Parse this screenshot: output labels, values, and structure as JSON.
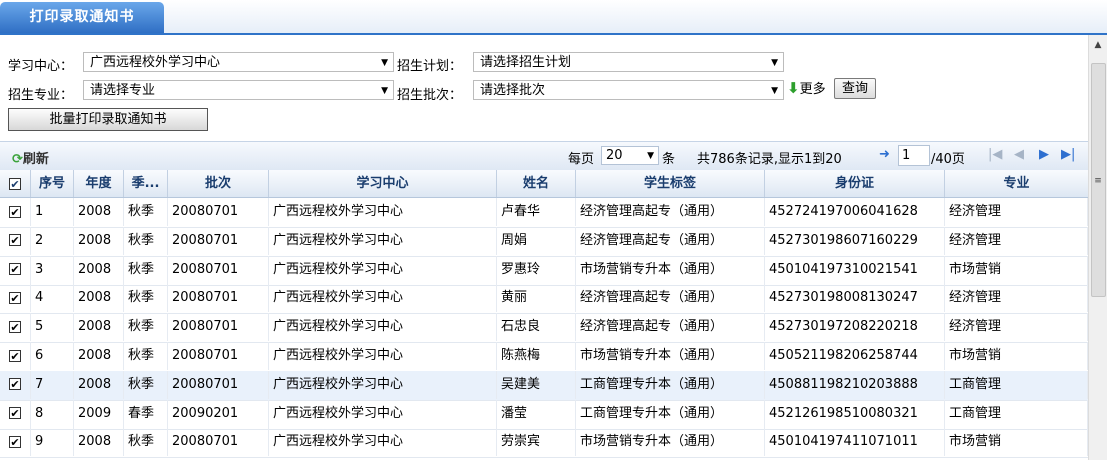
{
  "tab": {
    "label": "打印录取通知书"
  },
  "filters": {
    "center_label": "学习中心：",
    "center_value": "广西远程校外学习中心",
    "plan_label": "招生计划：",
    "plan_value": "请选择招生计划",
    "major_label": "招生专业：",
    "major_value": "请选择专业",
    "batch_label": "招生批次：",
    "batch_value": "请选择批次",
    "more_label": "更多",
    "query_label": "查询"
  },
  "batch_print_label": "批量打印录取通知书",
  "toolbar": {
    "refresh_label": "刷新",
    "per_page_label": "每页",
    "per_page_value": "20",
    "per_page_unit": "条",
    "records_text": "共786条记录,显示1到20",
    "page_input": "1",
    "total_pages": "/40页"
  },
  "columns": [
    "序号",
    "年度",
    "季...",
    "批次",
    "学习中心",
    "姓名",
    "学生标签",
    "身份证",
    "专业"
  ],
  "rows": [
    {
      "no": "1",
      "year": "2008",
      "season": "秋季",
      "batch": "20080701",
      "center": "广西远程校外学习中心",
      "name": "卢春华",
      "tag": "经济管理高起专（通用）",
      "id": "452724197006041628",
      "major": "经济管理"
    },
    {
      "no": "2",
      "year": "2008",
      "season": "秋季",
      "batch": "20080701",
      "center": "广西远程校外学习中心",
      "name": "周娟",
      "tag": "经济管理高起专（通用）",
      "id": "452730198607160229",
      "major": "经济管理"
    },
    {
      "no": "3",
      "year": "2008",
      "season": "秋季",
      "batch": "20080701",
      "center": "广西远程校外学习中心",
      "name": "罗惠玲",
      "tag": "市场营销专升本（通用）",
      "id": "450104197310021541",
      "major": "市场营销"
    },
    {
      "no": "4",
      "year": "2008",
      "season": "秋季",
      "batch": "20080701",
      "center": "广西远程校外学习中心",
      "name": "黄丽",
      "tag": "经济管理高起专（通用）",
      "id": "452730198008130247",
      "major": "经济管理"
    },
    {
      "no": "5",
      "year": "2008",
      "season": "秋季",
      "batch": "20080701",
      "center": "广西远程校外学习中心",
      "name": "石忠良",
      "tag": "经济管理高起专（通用）",
      "id": "452730197208220218",
      "major": "经济管理"
    },
    {
      "no": "6",
      "year": "2008",
      "season": "秋季",
      "batch": "20080701",
      "center": "广西远程校外学习中心",
      "name": "陈燕梅",
      "tag": "市场营销专升本（通用）",
      "id": "450521198206258744",
      "major": "市场营销"
    },
    {
      "no": "7",
      "year": "2008",
      "season": "秋季",
      "batch": "20080701",
      "center": "广西远程校外学习中心",
      "name": "吴建美",
      "tag": "工商管理专升本（通用）",
      "id": "450881198210203888",
      "major": "工商管理"
    },
    {
      "no": "8",
      "year": "2009",
      "season": "春季",
      "batch": "20090201",
      "center": "广西远程校外学习中心",
      "name": "潘莹",
      "tag": "工商管理专升本（通用）",
      "id": "452126198510080321",
      "major": "工商管理"
    },
    {
      "no": "9",
      "year": "2008",
      "season": "秋季",
      "batch": "20080701",
      "center": "广西远程校外学习中心",
      "name": "劳崇宾",
      "tag": "市场营销专升本（通用）",
      "id": "450104197411071011",
      "major": "市场营销"
    }
  ],
  "colors": {
    "tab_bg": "#2f6fc4",
    "header_text": "#1a3d6e",
    "highlight_row": "#e9f1fb"
  }
}
